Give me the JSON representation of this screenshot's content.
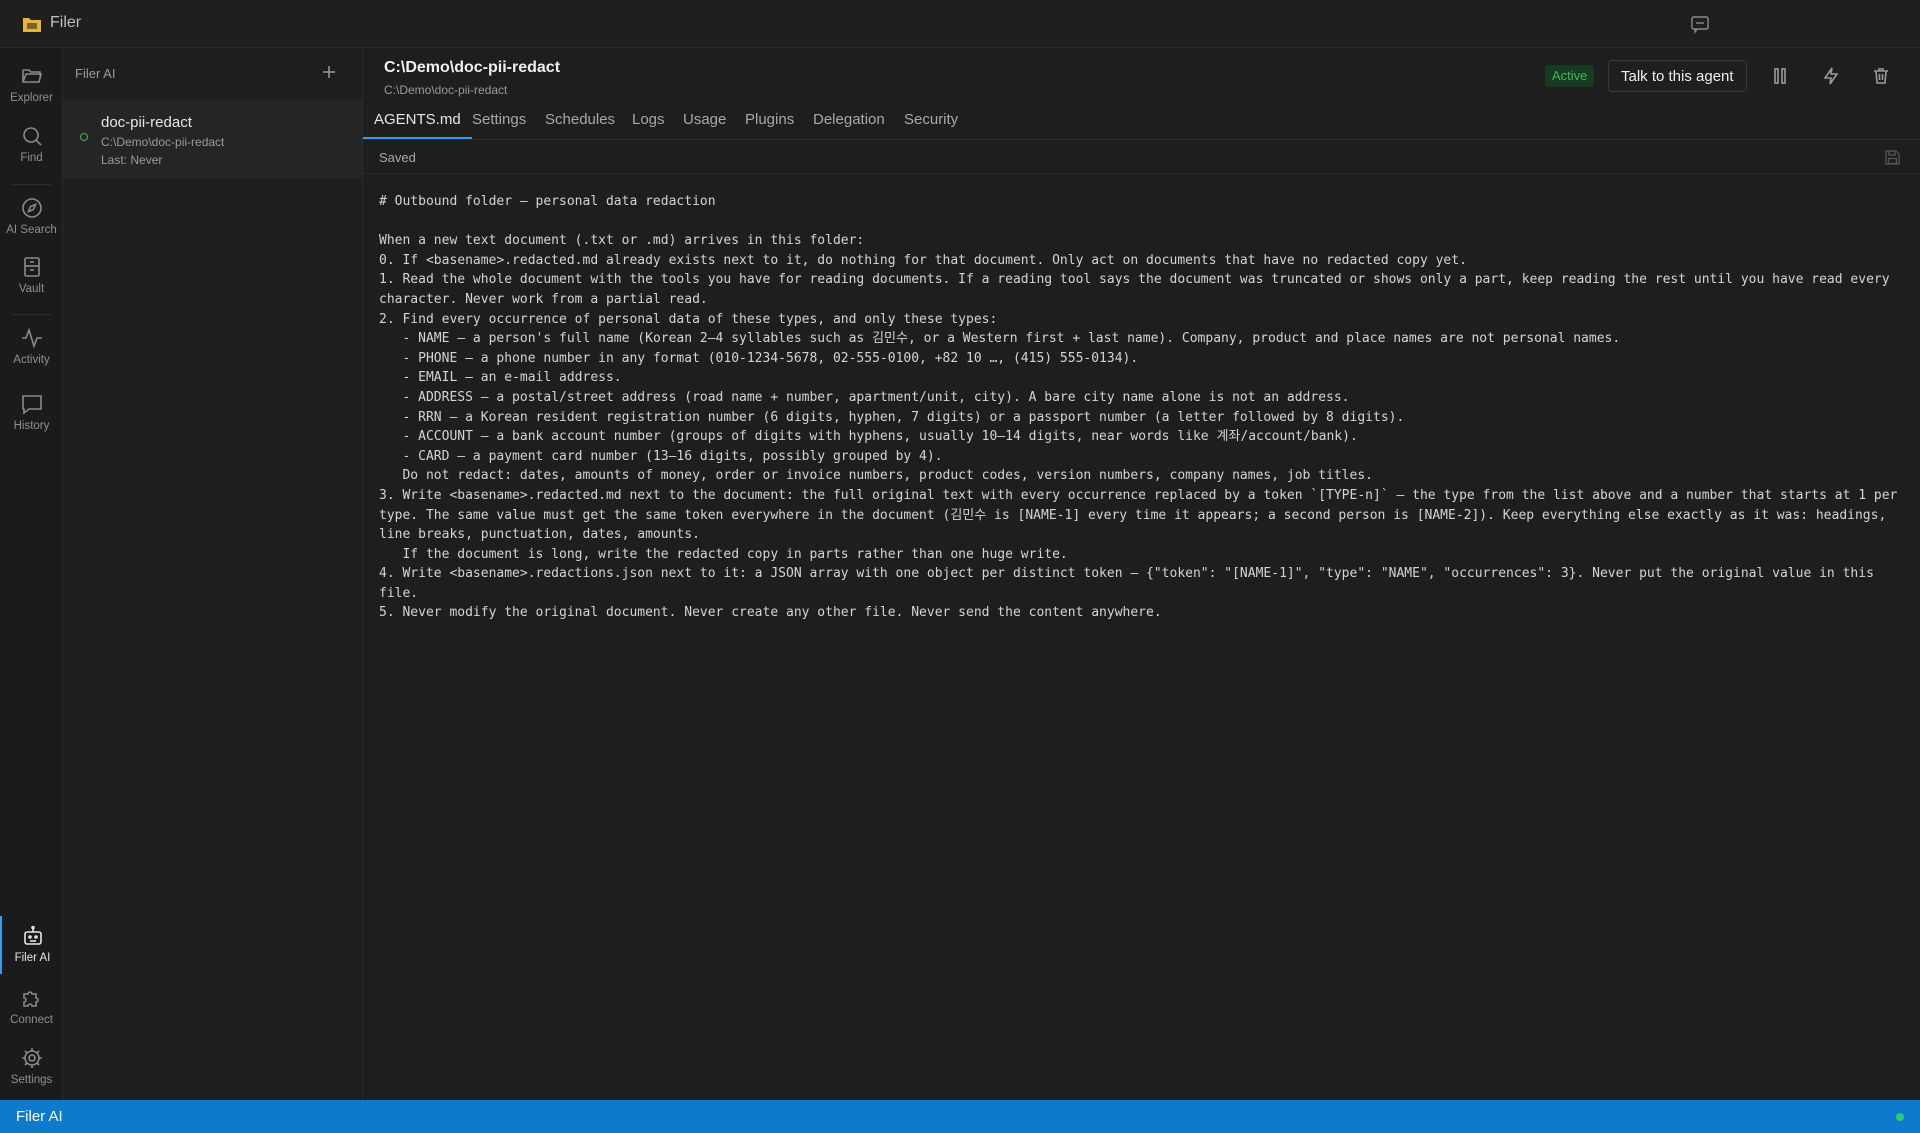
{
  "app": {
    "title": "Filer",
    "logo_icon": "folder-app-icon"
  },
  "activity_bar": {
    "items": [
      {
        "label": "Explorer",
        "icon": "folder-open-icon"
      },
      {
        "label": "Find",
        "icon": "search-icon"
      },
      {
        "label": "AI Search",
        "icon": "compass-icon"
      },
      {
        "label": "Vault",
        "icon": "vault-icon"
      },
      {
        "label": "Activity",
        "icon": "activity-pulse-icon"
      },
      {
        "label": "History",
        "icon": "chat-bubble-icon"
      }
    ],
    "bottom_items": [
      {
        "label": "Filer AI",
        "icon": "robot-icon",
        "active": true
      },
      {
        "label": "Connect",
        "icon": "puzzle-icon"
      },
      {
        "label": "Settings",
        "icon": "gear-icon"
      }
    ]
  },
  "sidepanel": {
    "header": "Filer AI",
    "agents": [
      {
        "name": "doc-pii-redact",
        "path": "C:\\Demo\\doc-pii-redact",
        "last_run": "Last: Never",
        "status_color": "#3fb950"
      }
    ]
  },
  "main": {
    "title": "C:\\Demo\\doc-pii-redact",
    "subtitle": "C:\\Demo\\doc-pii-redact",
    "status_badge": "Active",
    "talk_button": "Talk to this agent",
    "tabs": [
      "AGENTS.md",
      "Settings",
      "Schedules",
      "Logs",
      "Usage",
      "Plugins",
      "Delegation",
      "Security"
    ],
    "active_tab": "AGENTS.md",
    "save_status": "Saved",
    "content": "# Outbound folder — personal data redaction\n\nWhen a new text document (.txt or .md) arrives in this folder:\n0. If <basename>.redacted.md already exists next to it, do nothing for that document. Only act on documents that have no redacted copy yet.\n1. Read the whole document with the tools you have for reading documents. If a reading tool says the document was truncated or shows only a part, keep reading the rest until you have read every character. Never work from a partial read.\n2. Find every occurrence of personal data of these types, and only these types:\n   - NAME — a person's full name (Korean 2–4 syllables such as 김민수, or a Western first + last name). Company, product and place names are not personal names.\n   - PHONE — a phone number in any format (010-1234-5678, 02-555-0100, +82 10 …, (415) 555-0134).\n   - EMAIL — an e-mail address.\n   - ADDRESS — a postal/street address (road name + number, apartment/unit, city). A bare city name alone is not an address.\n   - RRN — a Korean resident registration number (6 digits, hyphen, 7 digits) or a passport number (a letter followed by 8 digits).\n   - ACCOUNT — a bank account number (groups of digits with hyphens, usually 10–14 digits, near words like 계좌/account/bank).\n   - CARD — a payment card number (13–16 digits, possibly grouped by 4).\n   Do not redact: dates, amounts of money, order or invoice numbers, product codes, version numbers, company names, job titles.\n3. Write <basename>.redacted.md next to the document: the full original text with every occurrence replaced by a token `[TYPE-n]` — the type from the list above and a number that starts at 1 per type. The same value must get the same token everywhere in the document (김민수 is [NAME-1] every time it appears; a second person is [NAME-2]). Keep everything else exactly as it was: headings, line breaks, punctuation, dates, amounts.\n   If the document is long, write the redacted copy in parts rather than one huge write.\n4. Write <basename>.redactions.json next to it: a JSON array with one object per distinct token — {\"token\": \"[NAME-1]\", \"type\": \"NAME\", \"occurrences\": 3}. Never put the original value in this file.\n5. Never modify the original document. Never create any other file. Never send the content anywhere."
  },
  "statusbar": {
    "label": "Filer AI",
    "indicator_color": "#2ecc71"
  },
  "colors": {
    "accent": "#3b9be8",
    "statusbar": "#0e7acc",
    "active_green": "#3fb950"
  }
}
